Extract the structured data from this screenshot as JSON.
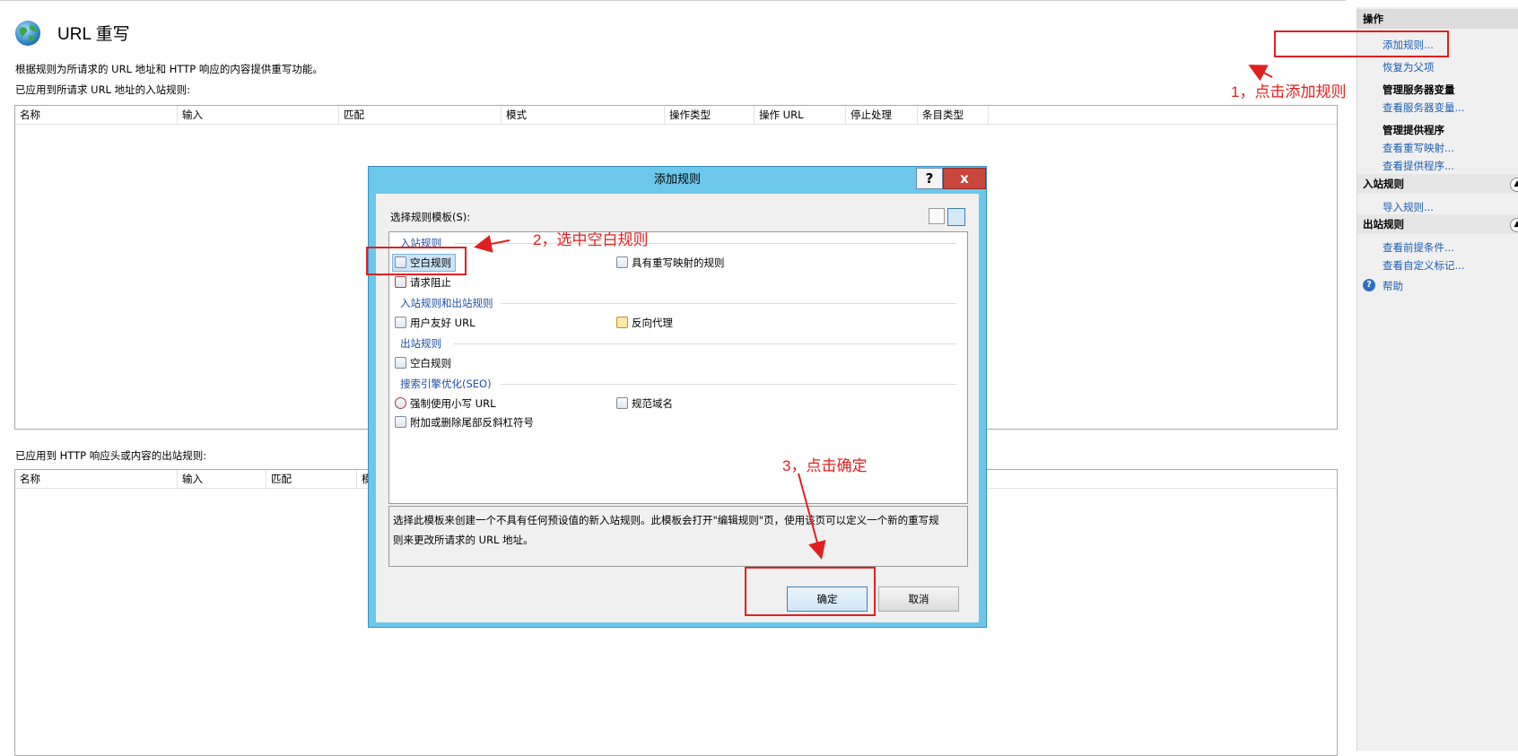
{
  "main": {
    "title": "URL 重写",
    "description": "根据规则为所请求的 URL 地址和 HTTP 响应的内容提供重写功能。",
    "inbound_label": "已应用到所请求 URL 地址的入站规则:",
    "inbound_columns": [
      "名称",
      "输入",
      "匹配",
      "模式",
      "操作类型",
      "操作 URL",
      "停止处理",
      "条目类型"
    ],
    "outbound_label": "已应用到 HTTP 响应头或内容的出站规则:",
    "outbound_columns": [
      "名称",
      "输入",
      "匹配",
      "模"
    ]
  },
  "side": {
    "ops_header": "操作",
    "add_rule": "添加规则...",
    "revert_parent": "恢复为父项",
    "server_vars_head": "管理服务器变量",
    "view_server_vars": "查看服务器变量...",
    "providers_head": "管理提供程序",
    "view_rewrite_maps": "查看重写映射...",
    "view_providers": "查看提供程序...",
    "inbound_group": "入站规则",
    "import_rules": "导入规则...",
    "outbound_group": "出站规则",
    "view_preconditions": "查看前提条件...",
    "view_custom_tags": "查看自定义标记...",
    "help": "帮助"
  },
  "dialog": {
    "title": "添加规则",
    "help_btn": "?",
    "close_btn": "x",
    "select_label": "选择规则模板(S):",
    "cat_inbound": "入站规则",
    "blank_rule": "空白规则",
    "rewrite_map_rule": "具有重写映射的规则",
    "request_blocking": "请求阻止",
    "cat_in_out": "入站规则和出站规则",
    "friendly_url": "用户友好 URL",
    "reverse_proxy": "反向代理",
    "cat_outbound": "出站规则",
    "blank_out_rule": "空白规则",
    "cat_seo": "搜索引擎优化(SEO)",
    "lowercase_url": "强制使用小写 URL",
    "canonical_domain": "规范域名",
    "trailing_slash": "附加或删除尾部反斜杠符号",
    "description_line1": "选择此模板来创建一个不具有任何预设值的新入站规则。此模板会打开\"编辑规则\"页，使用该页可以定义一个新的重写规",
    "description_line2": "则来更改所请求的 URL 地址。",
    "ok": "确定",
    "cancel": "取消"
  },
  "annotations": {
    "step1": "1，点击添加规则",
    "step2": "2，选中空白规则",
    "step3": "3，点击确定",
    "color": "#e02020"
  },
  "colors": {
    "dialog_frame": "#6cc7ea",
    "link": "#1c5fb3",
    "category": "#1e4fa6"
  }
}
